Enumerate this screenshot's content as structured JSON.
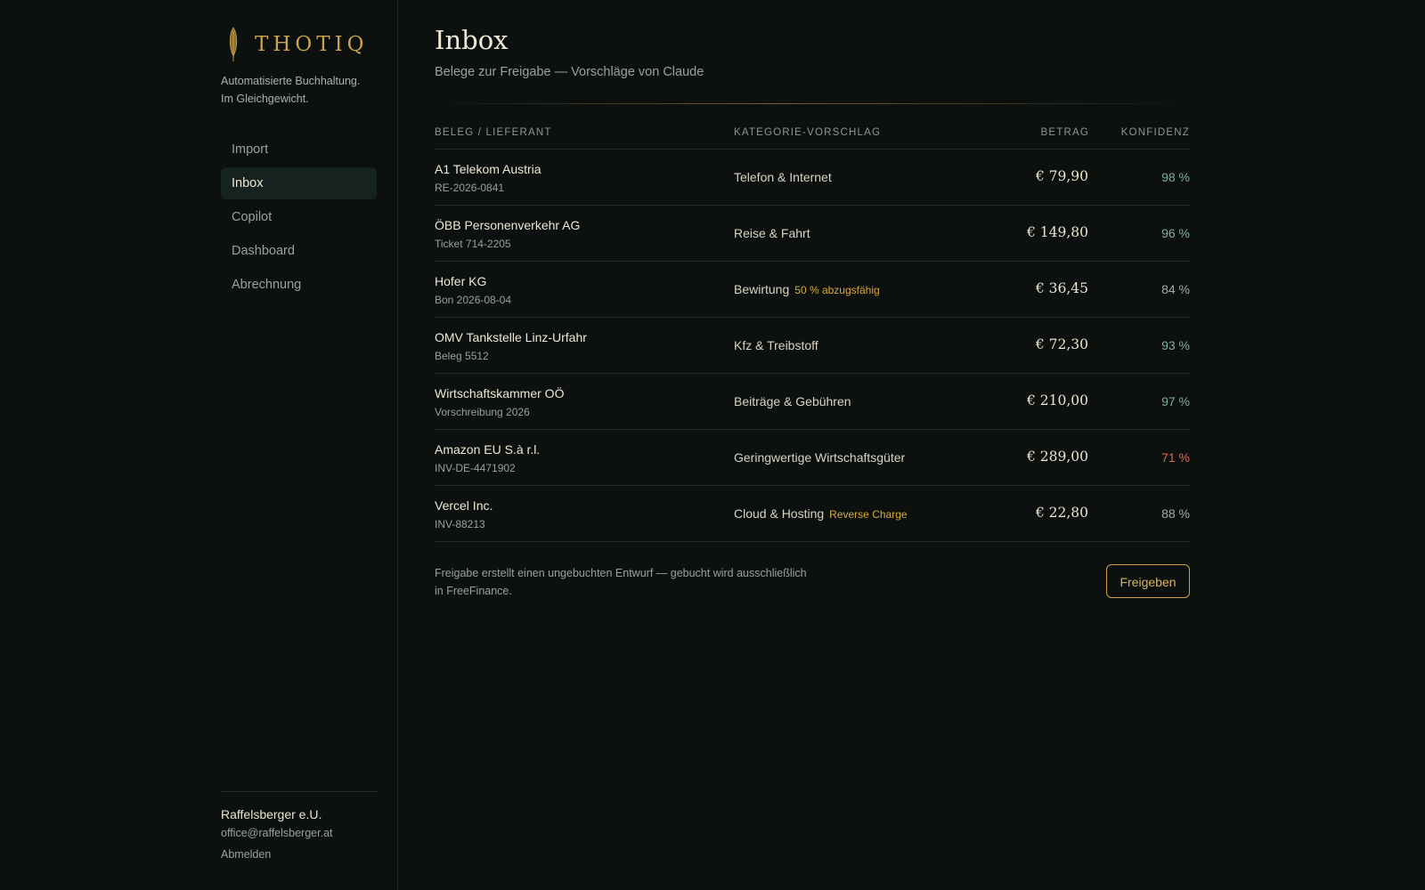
{
  "app": {
    "brand_name": "THOTIQ",
    "tagline_line1": "Automatisierte Buchhaltung.",
    "tagline_line2": "Im Gleichgewicht."
  },
  "sidebar": {
    "items": [
      {
        "label": "Import",
        "active": false
      },
      {
        "label": "Inbox",
        "active": true
      },
      {
        "label": "Copilot",
        "active": false
      },
      {
        "label": "Dashboard",
        "active": false
      },
      {
        "label": "Abrechnung",
        "active": false
      }
    ],
    "account": {
      "name": "Raffelsberger e.U.",
      "email": "office@raffelsberger.at",
      "logout_label": "Abmelden"
    }
  },
  "main": {
    "title": "Inbox",
    "subtitle": "Belege zur Freigabe — Vorschläge von Claude",
    "columns": {
      "vendor": "BELEG / LIEFERANT",
      "category": "KATEGORIE-VORSCHLAG",
      "amount": "BETRAG",
      "confidence": "KONFIDENZ"
    },
    "rows": [
      {
        "vendor": "A1 Telekom Austria",
        "ref": "RE-2026-0841",
        "category": "Telefon & Internet",
        "badge": "",
        "amount": "€ 79,90",
        "confidence": "98 %",
        "confidence_color": "#7fae94"
      },
      {
        "vendor": "ÖBB Personenverkehr AG",
        "ref": "Ticket 714-2205",
        "category": "Reise & Fahrt",
        "badge": "",
        "amount": "€ 149,80",
        "confidence": "96 %",
        "confidence_color": "#7fae94"
      },
      {
        "vendor": "Hofer KG",
        "ref": "Bon 2026-08-04",
        "category": "Bewirtung",
        "badge": "50 % abzugsfähig",
        "amount": "€ 36,45",
        "confidence": "84 %",
        "confidence_color": "#a1aca6"
      },
      {
        "vendor": "OMV Tankstelle Linz-Urfahr",
        "ref": "Beleg 5512",
        "category": "Kfz & Treibstoff",
        "badge": "",
        "amount": "€ 72,30",
        "confidence": "93 %",
        "confidence_color": "#7fae94"
      },
      {
        "vendor": "Wirtschaftskammer OÖ",
        "ref": "Vorschreibung 2026",
        "category": "Beiträge & Gebühren",
        "badge": "",
        "amount": "€ 210,00",
        "confidence": "97 %",
        "confidence_color": "#7fae94"
      },
      {
        "vendor": "Amazon EU S.à r.l.",
        "ref": "INV-DE-4471902",
        "category": "Geringwertige Wirtschaftsgüter",
        "badge": "",
        "amount": "€ 289,00",
        "confidence": "71 %",
        "confidence_color": "#d9674a"
      },
      {
        "vendor": "Vercel Inc.",
        "ref": "INV-88213",
        "category": "Cloud & Hosting",
        "badge": "Reverse Charge",
        "amount": "€ 22,80",
        "confidence": "88 %",
        "confidence_color": "#a1aca6"
      }
    ],
    "footnote": "Freigabe erstellt einen ungebuchten Entwurf — gebucht wird ausschließlich in FreeFinance.",
    "approve_label": "Freigeben"
  },
  "colors": {
    "background": "#0c1110",
    "accent_gold": "#c9a34e",
    "badge_gold": "#d9a93c",
    "nav_active_bg": "#16221f",
    "confidence_high": "#7fae94",
    "confidence_mid": "#a1aca6",
    "confidence_low": "#d9674a"
  },
  "icons": {
    "brand": "feather-icon"
  }
}
